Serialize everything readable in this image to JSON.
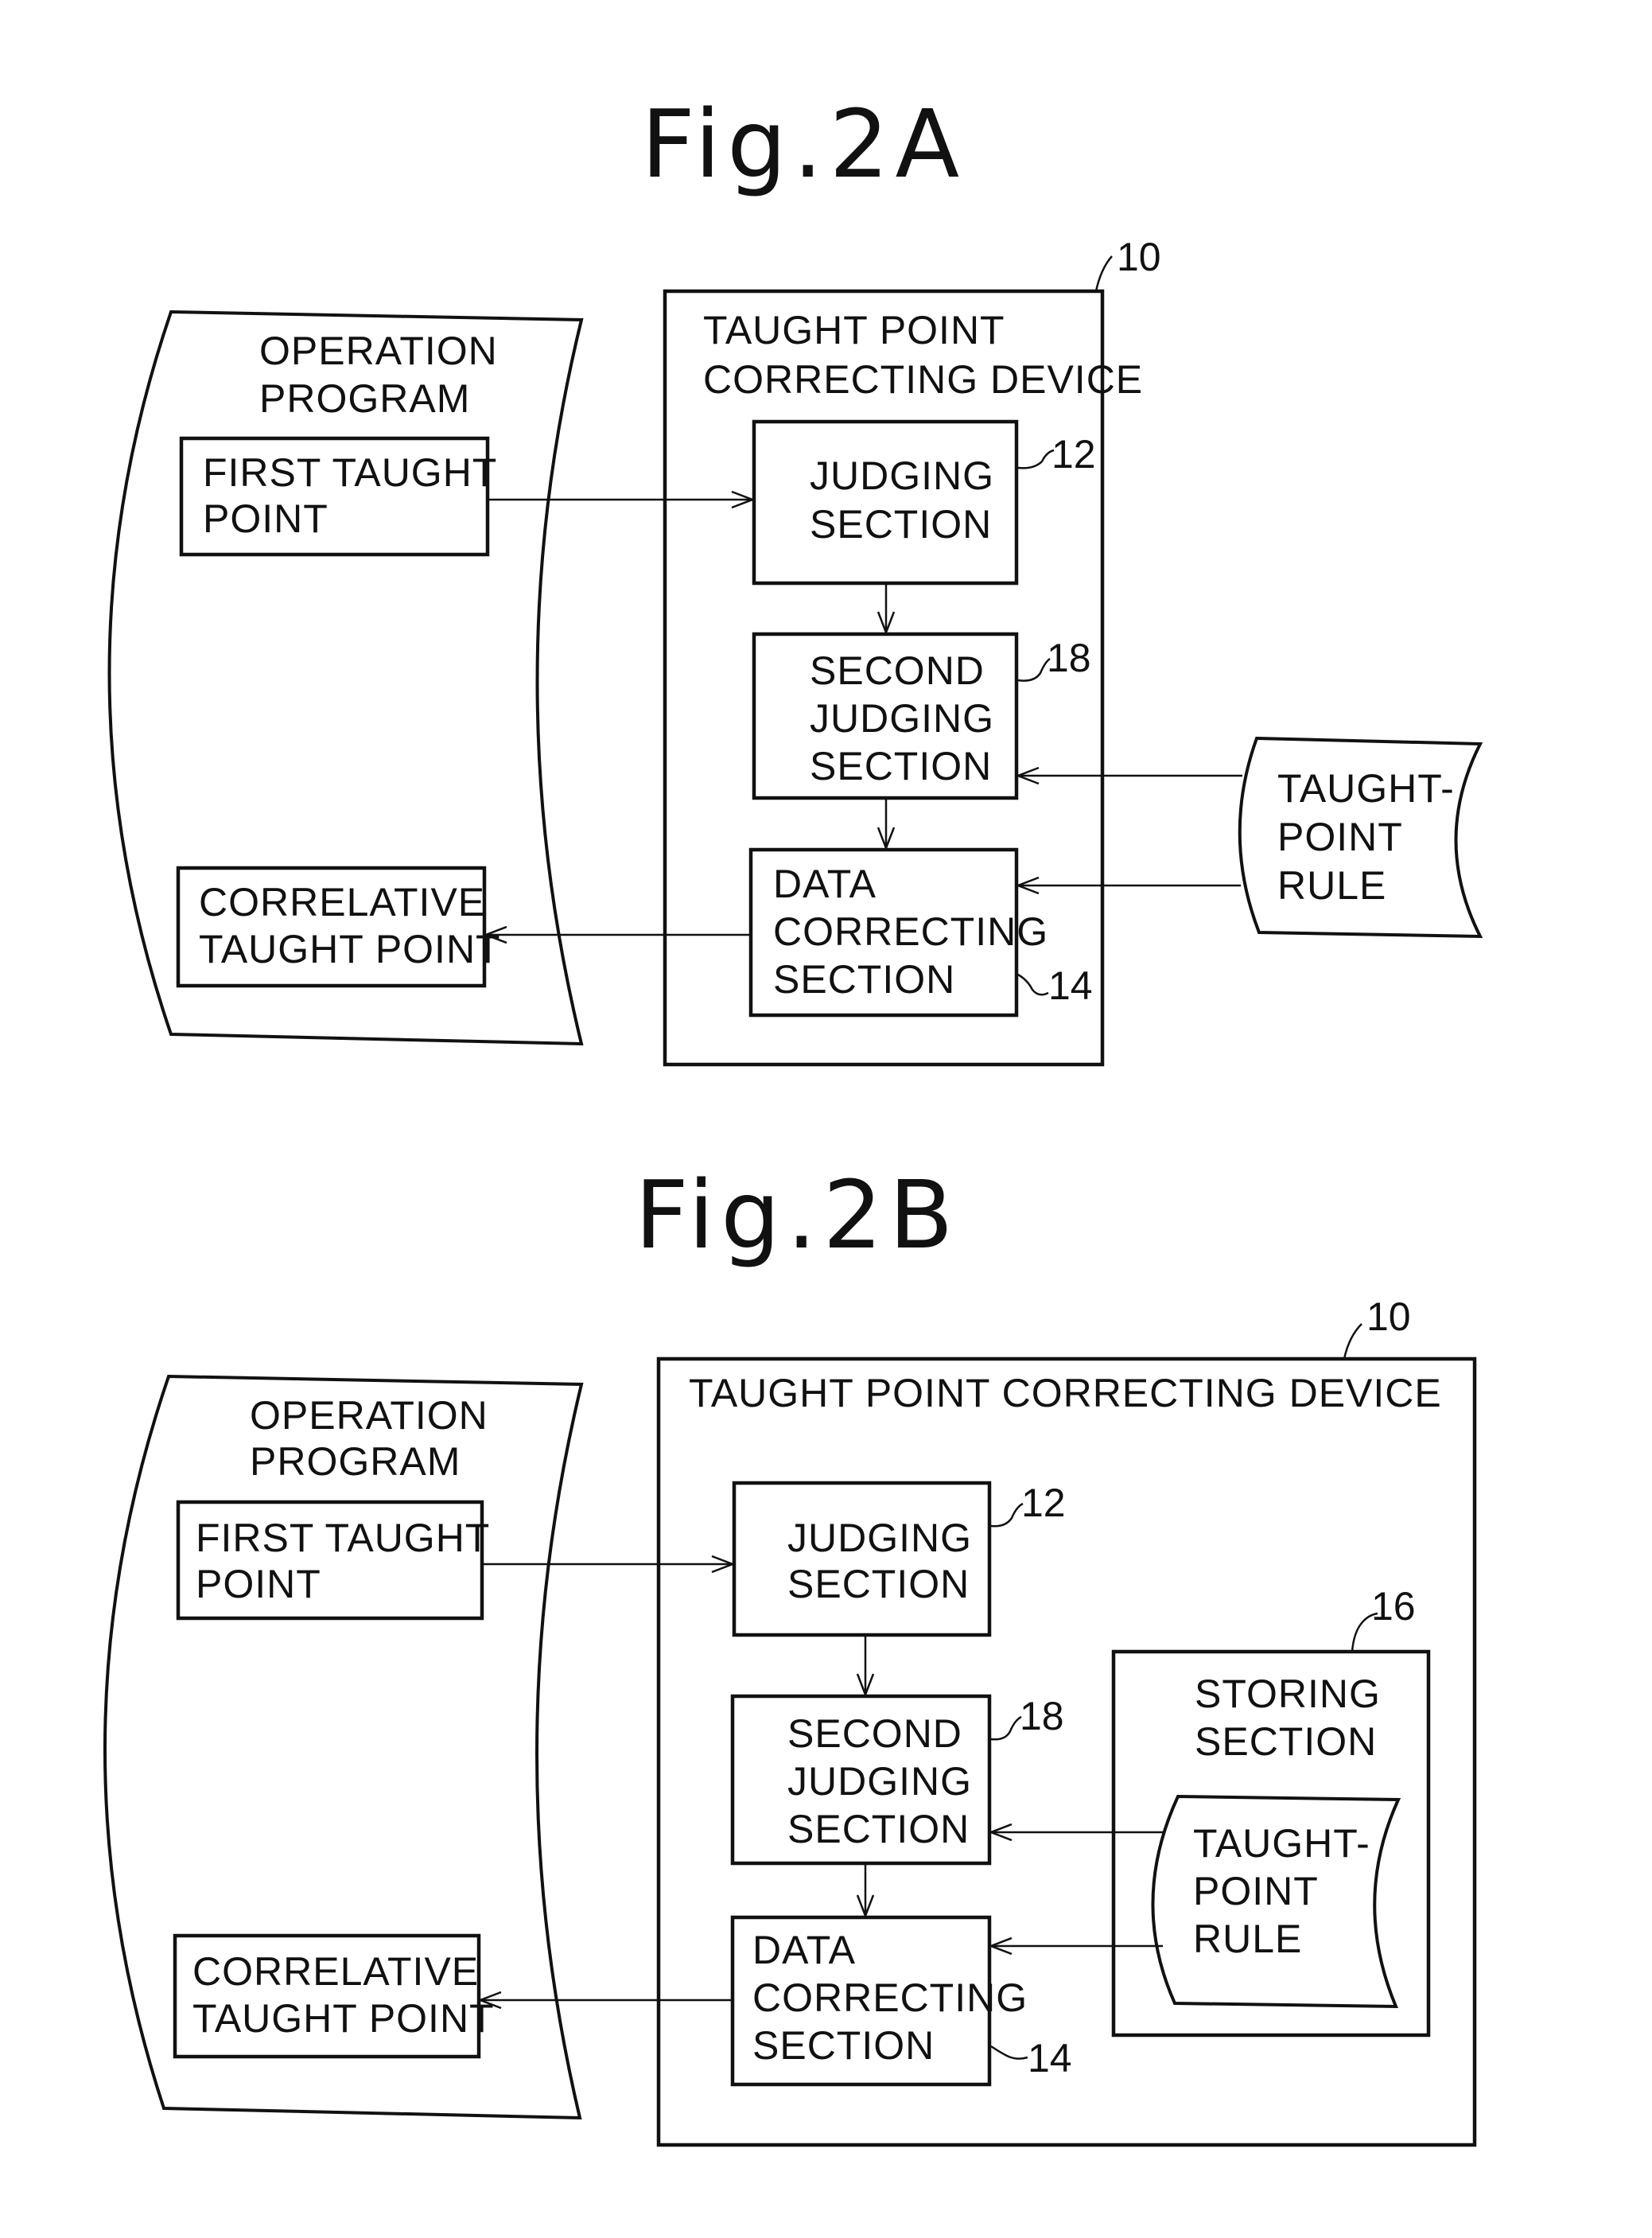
{
  "fig_a": {
    "title": "Fig.2A",
    "operation_program": {
      "line1": "OPERATION",
      "line2": "PROGRAM"
    },
    "first_taught_point": {
      "line1": "FIRST TAUGHT",
      "line2": "POINT"
    },
    "correlative_taught_point": {
      "line1": "CORRELATIVE",
      "line2": "TAUGHT POINT"
    },
    "device": {
      "line1": "TAUGHT POINT",
      "line2": "CORRECTING DEVICE",
      "ref": "10"
    },
    "judging_section": {
      "line1": "JUDGING",
      "line2": "SECTION",
      "ref": "12"
    },
    "second_judging_section": {
      "line1": "SECOND",
      "line2": "JUDGING",
      "line3": "SECTION",
      "ref": "18"
    },
    "data_correcting_section": {
      "line1": "DATA",
      "line2": "CORRECTING",
      "line3": "SECTION",
      "ref": "14"
    },
    "taught_point_rule": {
      "line1": "TAUGHT-",
      "line2": "POINT",
      "line3": "RULE"
    }
  },
  "fig_b": {
    "title": "Fig.2B",
    "operation_program": {
      "line1": "OPERATION",
      "line2": "PROGRAM"
    },
    "first_taught_point": {
      "line1": "FIRST TAUGHT",
      "line2": "POINT"
    },
    "correlative_taught_point": {
      "line1": "CORRELATIVE",
      "line2": "TAUGHT POINT"
    },
    "device": {
      "line1": "TAUGHT POINT CORRECTING DEVICE",
      "ref": "10"
    },
    "judging_section": {
      "line1": "JUDGING",
      "line2": "SECTION",
      "ref": "12"
    },
    "second_judging_section": {
      "line1": "SECOND",
      "line2": "JUDGING",
      "line3": "SECTION",
      "ref": "18"
    },
    "data_correcting_section": {
      "line1": "DATA",
      "line2": "CORRECTING",
      "line3": "SECTION",
      "ref": "14"
    },
    "storing_section": {
      "line1": "STORING",
      "line2": "SECTION",
      "ref": "16"
    },
    "taught_point_rule": {
      "line1": "TAUGHT-",
      "line2": "POINT",
      "line3": "RULE"
    }
  }
}
